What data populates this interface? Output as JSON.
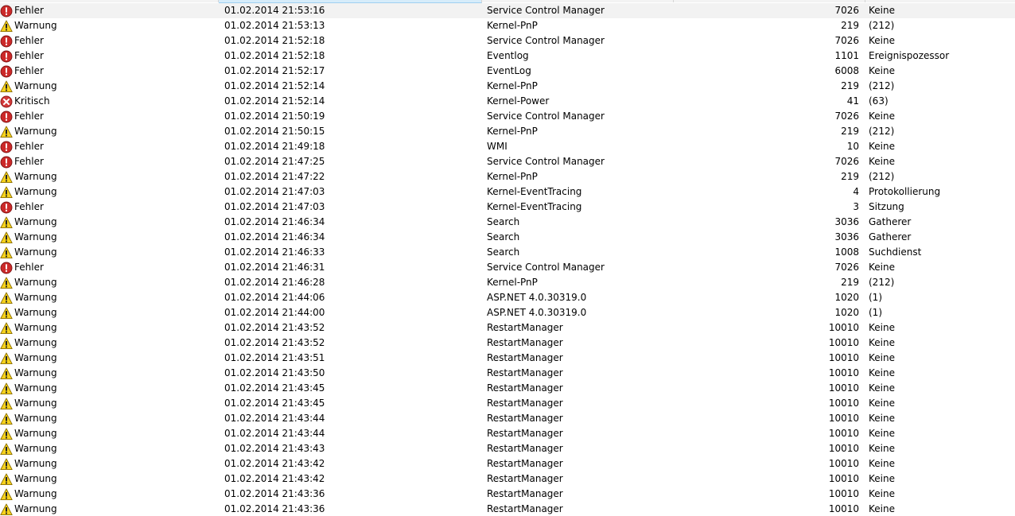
{
  "colors": {
    "error_red": "#cc2a2a",
    "warning_yellow": "#f6d21c",
    "critical_red": "#d23a3a"
  },
  "events": [
    {
      "level": "Fehler",
      "icon": "error-icon",
      "date": "01.02.2014 21:53:16",
      "source": "Service Control Manager",
      "id": "7026",
      "task": "Keine"
    },
    {
      "level": "Warnung",
      "icon": "warning-icon",
      "date": "01.02.2014 21:53:13",
      "source": "Kernel-PnP",
      "id": "219",
      "task": "(212)"
    },
    {
      "level": "Fehler",
      "icon": "error-icon",
      "date": "01.02.2014 21:52:18",
      "source": "Service Control Manager",
      "id": "7026",
      "task": "Keine"
    },
    {
      "level": "Fehler",
      "icon": "error-icon",
      "date": "01.02.2014 21:52:18",
      "source": "Eventlog",
      "id": "1101",
      "task": "Ereignispozessor"
    },
    {
      "level": "Fehler",
      "icon": "error-icon",
      "date": "01.02.2014 21:52:17",
      "source": "EventLog",
      "id": "6008",
      "task": "Keine"
    },
    {
      "level": "Warnung",
      "icon": "warning-icon",
      "date": "01.02.2014 21:52:14",
      "source": "Kernel-PnP",
      "id": "219",
      "task": "(212)"
    },
    {
      "level": "Kritisch",
      "icon": "critical-icon",
      "date": "01.02.2014 21:52:14",
      "source": "Kernel-Power",
      "id": "41",
      "task": "(63)"
    },
    {
      "level": "Fehler",
      "icon": "error-icon",
      "date": "01.02.2014 21:50:19",
      "source": "Service Control Manager",
      "id": "7026",
      "task": "Keine"
    },
    {
      "level": "Warnung",
      "icon": "warning-icon",
      "date": "01.02.2014 21:50:15",
      "source": "Kernel-PnP",
      "id": "219",
      "task": "(212)"
    },
    {
      "level": "Fehler",
      "icon": "error-icon",
      "date": "01.02.2014 21:49:18",
      "source": "WMI",
      "id": "10",
      "task": "Keine"
    },
    {
      "level": "Fehler",
      "icon": "error-icon",
      "date": "01.02.2014 21:47:25",
      "source": "Service Control Manager",
      "id": "7026",
      "task": "Keine"
    },
    {
      "level": "Warnung",
      "icon": "warning-icon",
      "date": "01.02.2014 21:47:22",
      "source": "Kernel-PnP",
      "id": "219",
      "task": "(212)"
    },
    {
      "level": "Warnung",
      "icon": "warning-icon",
      "date": "01.02.2014 21:47:03",
      "source": "Kernel-EventTracing",
      "id": "4",
      "task": "Protokollierung"
    },
    {
      "level": "Fehler",
      "icon": "error-icon",
      "date": "01.02.2014 21:47:03",
      "source": "Kernel-EventTracing",
      "id": "3",
      "task": "Sitzung"
    },
    {
      "level": "Warnung",
      "icon": "warning-icon",
      "date": "01.02.2014 21:46:34",
      "source": "Search",
      "id": "3036",
      "task": "Gatherer"
    },
    {
      "level": "Warnung",
      "icon": "warning-icon",
      "date": "01.02.2014 21:46:34",
      "source": "Search",
      "id": "3036",
      "task": "Gatherer"
    },
    {
      "level": "Warnung",
      "icon": "warning-icon",
      "date": "01.02.2014 21:46:33",
      "source": "Search",
      "id": "1008",
      "task": "Suchdienst"
    },
    {
      "level": "Fehler",
      "icon": "error-icon",
      "date": "01.02.2014 21:46:31",
      "source": "Service Control Manager",
      "id": "7026",
      "task": "Keine"
    },
    {
      "level": "Warnung",
      "icon": "warning-icon",
      "date": "01.02.2014 21:46:28",
      "source": "Kernel-PnP",
      "id": "219",
      "task": "(212)"
    },
    {
      "level": "Warnung",
      "icon": "warning-icon",
      "date": "01.02.2014 21:44:06",
      "source": "ASP.NET 4.0.30319.0",
      "id": "1020",
      "task": "(1)"
    },
    {
      "level": "Warnung",
      "icon": "warning-icon",
      "date": "01.02.2014 21:44:00",
      "source": "ASP.NET 4.0.30319.0",
      "id": "1020",
      "task": "(1)"
    },
    {
      "level": "Warnung",
      "icon": "warning-icon",
      "date": "01.02.2014 21:43:52",
      "source": "RestartManager",
      "id": "10010",
      "task": "Keine"
    },
    {
      "level": "Warnung",
      "icon": "warning-icon",
      "date": "01.02.2014 21:43:52",
      "source": "RestartManager",
      "id": "10010",
      "task": "Keine"
    },
    {
      "level": "Warnung",
      "icon": "warning-icon",
      "date": "01.02.2014 21:43:51",
      "source": "RestartManager",
      "id": "10010",
      "task": "Keine"
    },
    {
      "level": "Warnung",
      "icon": "warning-icon",
      "date": "01.02.2014 21:43:50",
      "source": "RestartManager",
      "id": "10010",
      "task": "Keine"
    },
    {
      "level": "Warnung",
      "icon": "warning-icon",
      "date": "01.02.2014 21:43:45",
      "source": "RestartManager",
      "id": "10010",
      "task": "Keine"
    },
    {
      "level": "Warnung",
      "icon": "warning-icon",
      "date": "01.02.2014 21:43:45",
      "source": "RestartManager",
      "id": "10010",
      "task": "Keine"
    },
    {
      "level": "Warnung",
      "icon": "warning-icon",
      "date": "01.02.2014 21:43:44",
      "source": "RestartManager",
      "id": "10010",
      "task": "Keine"
    },
    {
      "level": "Warnung",
      "icon": "warning-icon",
      "date": "01.02.2014 21:43:44",
      "source": "RestartManager",
      "id": "10010",
      "task": "Keine"
    },
    {
      "level": "Warnung",
      "icon": "warning-icon",
      "date": "01.02.2014 21:43:43",
      "source": "RestartManager",
      "id": "10010",
      "task": "Keine"
    },
    {
      "level": "Warnung",
      "icon": "warning-icon",
      "date": "01.02.2014 21:43:42",
      "source": "RestartManager",
      "id": "10010",
      "task": "Keine"
    },
    {
      "level": "Warnung",
      "icon": "warning-icon",
      "date": "01.02.2014 21:43:42",
      "source": "RestartManager",
      "id": "10010",
      "task": "Keine"
    },
    {
      "level": "Warnung",
      "icon": "warning-icon",
      "date": "01.02.2014 21:43:36",
      "source": "RestartManager",
      "id": "10010",
      "task": "Keine"
    },
    {
      "level": "Warnung",
      "icon": "warning-icon",
      "date": "01.02.2014 21:43:36",
      "source": "RestartManager",
      "id": "10010",
      "task": "Keine"
    }
  ]
}
